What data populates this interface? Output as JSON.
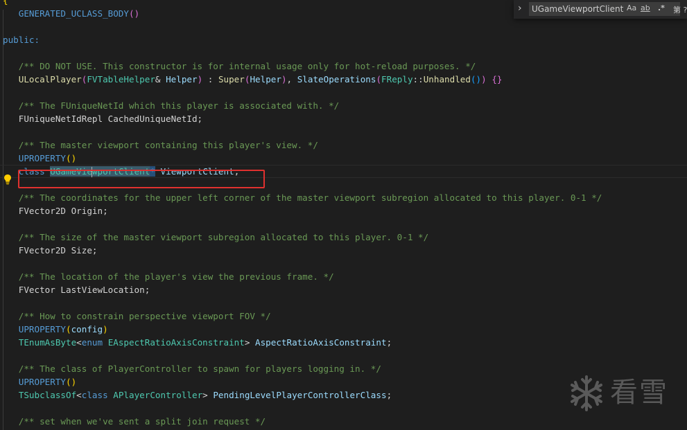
{
  "find_widget": {
    "query": "UGameViewportClient",
    "match_case_label": "Aa",
    "whole_word_label": "ab",
    "regex_label": ".*",
    "results_label": "第 ?"
  },
  "watermark": {
    "text": "看雪"
  },
  "code": {
    "brace_open": "{",
    "l_body": "GENERATED_UCLASS_BODY",
    "l_public": "public:",
    "c1": "/** DO NOT USE. This constructor is for internal usage only for hot-reload purposes. */",
    "ctor_name": "ULocalPlayer",
    "ctor_param_type": "FVTableHelper",
    "ctor_param_name": "Helper",
    "ctor_super": "Super",
    "ctor_slate": "SlateOperations",
    "ctor_freply": "FReply",
    "ctor_unhandled": "Unhandled",
    "c2": "/** The FUniqueNetId which this player is associated with. */",
    "l_netid": "FUniqueNetIdRepl CachedUniqueNetId;",
    "c3": "/** The master viewport containing this player's view. */",
    "uproperty": "UPROPERTY",
    "kw_class": "class",
    "vc_type_a": "UGameVie",
    "vc_type_b": "wportClient",
    "vc_ptr": "*",
    "vc_name": "ViewportClient",
    "c4": "/** The coordinates for the upper left corner of the master viewport subregion allocated to this player. 0-1 */",
    "l_origin": "FVector2D Origin;",
    "c5": "/** The size of the master viewport subregion allocated to this player. 0-1 */",
    "l_size": "FVector2D Size;",
    "c6": "/** The location of the player's view the previous frame. */",
    "l_lastview": "FVector LastViewLocation;",
    "c7": "/** How to constrain perspective viewport FOV */",
    "up_config_arg": "config",
    "tenum": "TEnumAsByte",
    "kw_enum": "enum",
    "enum_type": "EAspectRatioAxisConstraint",
    "enum_var": "AspectRatioAxisConstraint",
    "c8": "/** The class of PlayerController to spawn for players logging in. */",
    "tsub": "TSubclassOf",
    "pc_type": "APlayerController",
    "pc_var": "PendingLevelPlayerControllerClass",
    "c9": "/** set when we've sent a split join request */"
  },
  "colors": {
    "background": "#1e1e1e",
    "comment": "#6a9955",
    "keyword": "#569cd6",
    "type": "#4ec9b0",
    "function": "#dcdcaa",
    "variable": "#9cdcfe",
    "highlight_box": "#e0312f"
  }
}
